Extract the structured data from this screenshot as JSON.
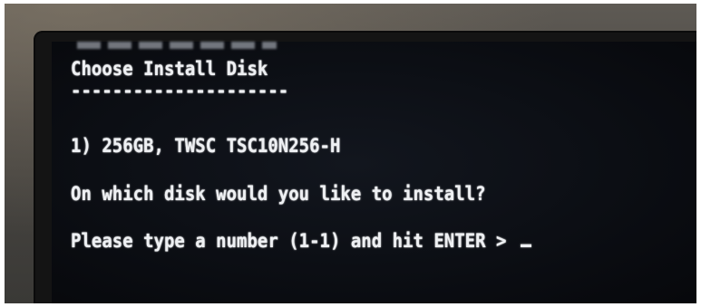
{
  "installer": {
    "title": "Choose Install Disk",
    "title_underline": "---------------------",
    "disk_option": "1) 256GB, TWSC TSC10N256-H",
    "question": "On which disk would you like to install?",
    "prompt": "Please type a number (1-1) and hit ENTER > "
  },
  "colors": {
    "screen_background": "#0a0c11",
    "text": "#eef0f3"
  }
}
